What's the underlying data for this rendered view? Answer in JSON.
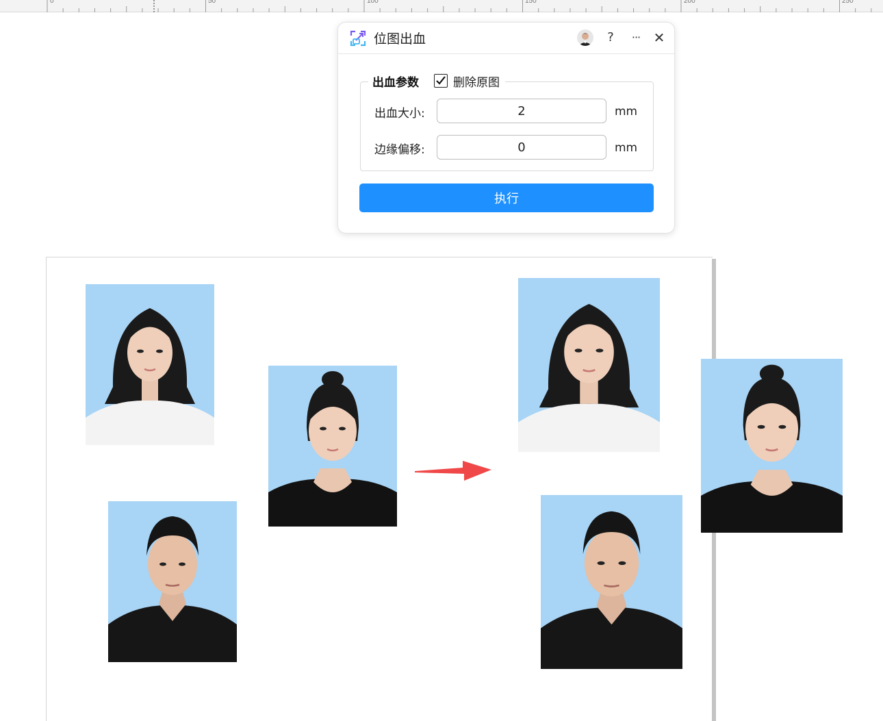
{
  "ruler": {
    "labels": [
      "0",
      "50",
      "100",
      "150",
      "200",
      "250"
    ]
  },
  "dialog": {
    "title": "位图出血",
    "help_label": "?",
    "more_label": "···",
    "close_label": "✕",
    "group_title": "出血参数",
    "delete_original_label": "删除原图",
    "delete_original_checked": true,
    "bleed_size_label": "出血大小:",
    "bleed_size_value": "2",
    "bleed_size_unit": "mm",
    "edge_offset_label": "边缘偏移:",
    "edge_offset_value": "0",
    "edge_offset_unit": "mm",
    "execute_label": "执行"
  },
  "colors": {
    "accent": "#1e90ff",
    "photo_background": "#a8d4f5",
    "arrow": "#f04848"
  }
}
